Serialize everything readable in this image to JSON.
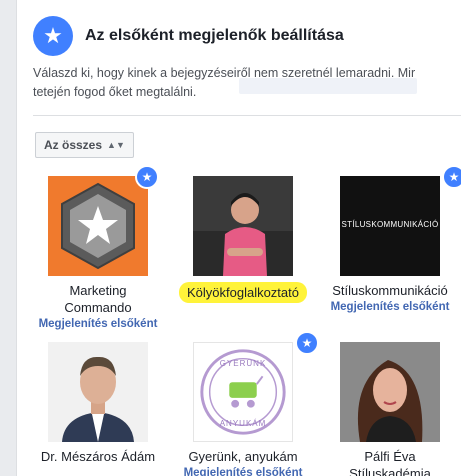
{
  "header": {
    "title": "Az elsőként megjelenők beállítása",
    "icon": "star-icon"
  },
  "description": {
    "line1": "Válaszd ki, hogy kinek a bejegyzéseiről nem szeretnél lemaradni. Mir",
    "line2": "tetején fogod őket megtalálni."
  },
  "filter": {
    "label": "Az összes"
  },
  "colors": {
    "accent": "#4080ff",
    "link": "#4267b2",
    "highlight": "#fff33a"
  },
  "cards": [
    {
      "name": "Marketing",
      "name2": "Commando",
      "action": "Megjelenítés elsőként",
      "starred": true
    },
    {
      "name": "Kölyökfoglalkoztató",
      "action": "",
      "starred": false
    },
    {
      "name": "Stíluskommunikáció",
      "action": "Megjelenítés elsőként",
      "starred": true,
      "logo_text": "STÍLUSKOMMUNIKÁCIÓ"
    },
    {
      "name": "Dr. Mészáros Ádám",
      "action": "",
      "starred": false
    },
    {
      "name": "Gyerünk, anyukám",
      "action": "Megjelenítés elsőként",
      "starred": true,
      "logo_top": "GYERÜNK",
      "logo_bottom": "ANYUKÁM"
    },
    {
      "name": "Pálfi Éva",
      "name2": "Stíluskadémia",
      "action": "",
      "starred": false
    }
  ]
}
